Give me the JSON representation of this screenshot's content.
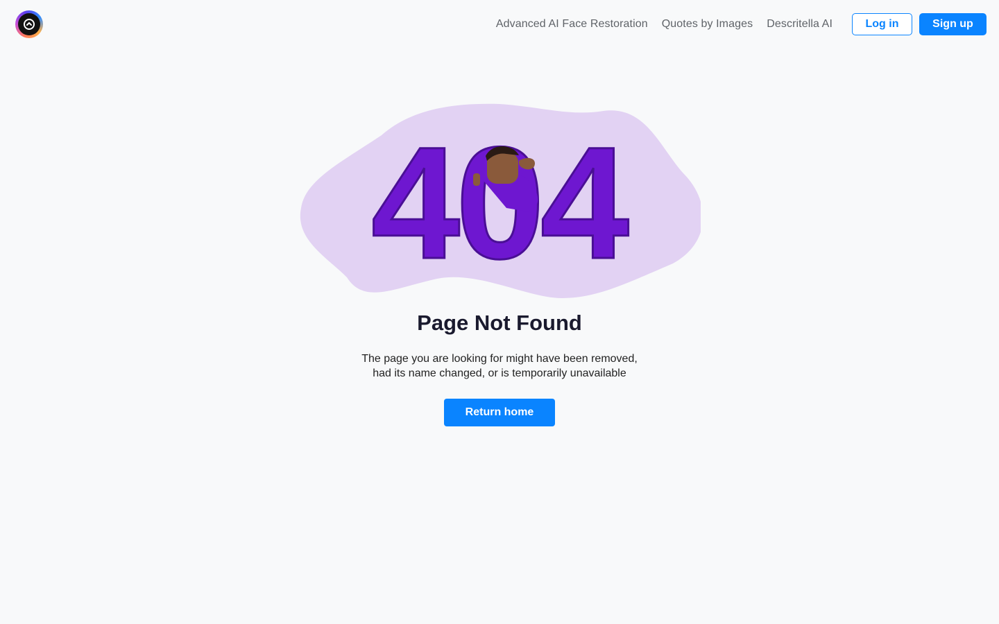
{
  "header": {
    "logo_icon": "circle-arrow-logo-icon",
    "nav": [
      {
        "label": "Advanced AI Face Restoration"
      },
      {
        "label": "Quotes by Images"
      },
      {
        "label": "Descritella AI"
      }
    ],
    "login_label": "Log in",
    "signup_label": "Sign up"
  },
  "error": {
    "illustration_text": "404",
    "title": "Page Not Found",
    "description_line1": "The page you are looking for might have been removed,",
    "description_line2": "had its name changed, or is temporarily unavailable",
    "return_label": "Return home"
  },
  "colors": {
    "accent": "#0a84ff",
    "purple": "#6e17d0",
    "blob": "#e2d2f3"
  }
}
